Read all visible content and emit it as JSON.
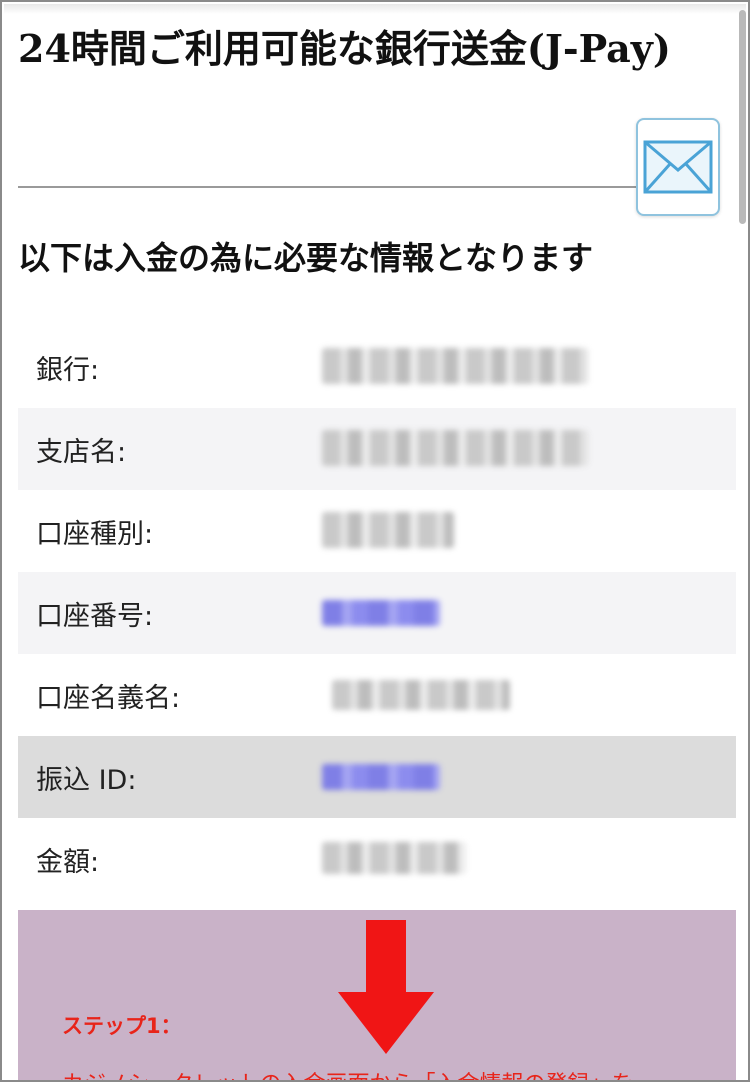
{
  "page": {
    "title": "24時間ご利用可能な銀行送金(J-Pay)",
    "subtitle": "以下は入金の為に必要な情報となります"
  },
  "mail_button": {
    "icon": "envelope-icon"
  },
  "bank_info": {
    "rows": [
      {
        "label": "銀行:",
        "value": "",
        "value_style": "plain",
        "background": "white"
      },
      {
        "label": "支店名:",
        "value": "",
        "value_style": "plain",
        "background": "alt"
      },
      {
        "label": "口座種別:",
        "value": "",
        "value_style": "plain",
        "background": "white"
      },
      {
        "label": "口座番号:",
        "value": "",
        "value_style": "link",
        "background": "alt"
      },
      {
        "label": "口座名義名:",
        "value": "",
        "value_style": "plain",
        "background": "white"
      },
      {
        "label": "振込 ID:",
        "value": "",
        "value_style": "link",
        "background": "highlight"
      },
      {
        "label": "金額:",
        "value": "",
        "value_style": "plain",
        "background": "white"
      }
    ]
  },
  "step_panel": {
    "label": "ステップ1：",
    "text": "カジノシークレットの入金画面から「入金情報の登録」を",
    "arrow_icon": "down-arrow-icon"
  },
  "colors": {
    "step_panel_bg": "#c9b2c8",
    "step_text": "#e8241a",
    "arrow": "#f01515",
    "mail_border": "#8fc3de",
    "mail_icon": "#4aa3d6"
  }
}
